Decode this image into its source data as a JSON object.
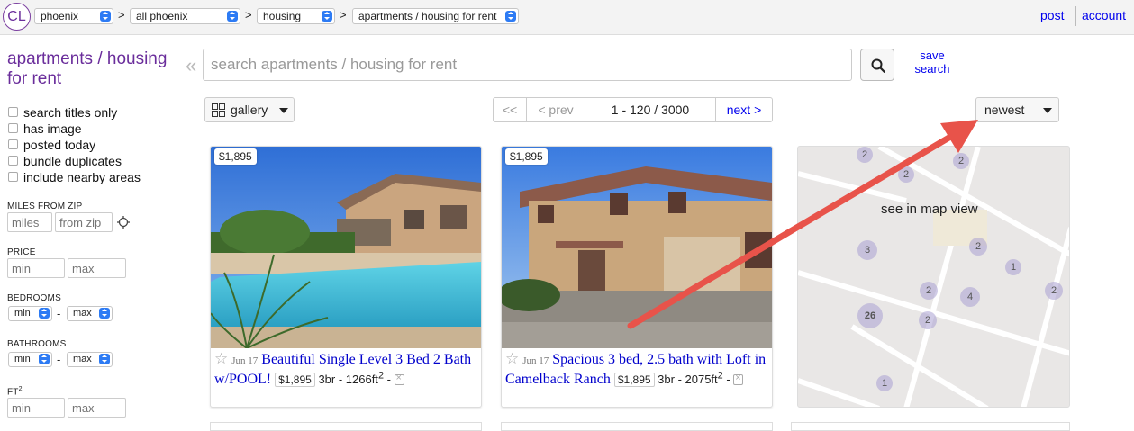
{
  "header": {
    "logo": "CL",
    "breadcrumbs": [
      {
        "label": "phoenix"
      },
      {
        "label": "all phoenix"
      },
      {
        "label": "housing"
      },
      {
        "label": "apartments / housing for rent"
      }
    ],
    "separator": ">",
    "post": "post",
    "account": "account"
  },
  "sidebar": {
    "title": "apartments / housing for rent",
    "checkboxes": [
      "search titles only",
      "has image",
      "posted today",
      "bundle duplicates",
      "include nearby areas"
    ],
    "miles_from_zip": {
      "label": "MILES FROM ZIP",
      "miles_placeholder": "miles",
      "zip_placeholder": "from zip"
    },
    "price": {
      "label": "PRICE",
      "min_placeholder": "min",
      "max_placeholder": "max"
    },
    "bedrooms": {
      "label": "BEDROOMS",
      "min": "min",
      "max": "max"
    },
    "bathrooms": {
      "label": "BATHROOMS",
      "min": "min",
      "max": "max"
    },
    "ft2": {
      "label": "FT",
      "sup": "2",
      "min_placeholder": "min",
      "max_placeholder": "max"
    },
    "dash": "-"
  },
  "search": {
    "collapse": "«",
    "placeholder": "search apartments / housing for rent",
    "save_line1": "save",
    "save_line2": "search"
  },
  "toolbar": {
    "view": "gallery",
    "pager": {
      "first": "<<",
      "prev": "< prev",
      "range": "1 - 120 / 3000",
      "next": "next >"
    },
    "sort": "newest"
  },
  "listings": [
    {
      "price": "$1,895",
      "date": "Jun 17",
      "title": "Beautiful Single Level 3 Bed 2 Bath w/POOL!",
      "mini_price": "$1,895",
      "details": "3br - 1266ft",
      "sup": "2",
      "tail": " -"
    },
    {
      "price": "$1,895",
      "date": "Jun 17",
      "title": "Spacious 3 bed, 2.5 bath with Loft in Camelback Ranch",
      "mini_price": "$1,895",
      "details": "3br - 2075ft",
      "sup": "2",
      "tail": " -"
    }
  ],
  "map": {
    "label": "see in map view",
    "clusters": [
      "2",
      "2",
      "2",
      "3",
      "2",
      "1",
      "2",
      "4",
      "2",
      "26",
      "2",
      "1"
    ]
  },
  "colors": {
    "accent_purple": "#6a2d9b",
    "link_blue": "#0000ee",
    "arrow_red": "#e8534a"
  }
}
